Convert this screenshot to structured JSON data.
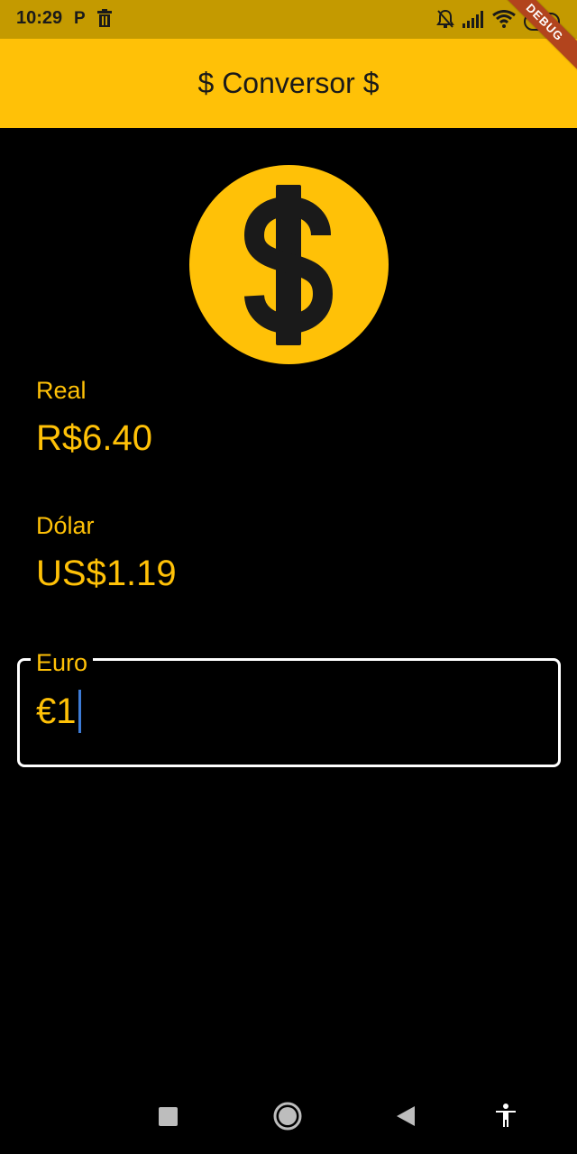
{
  "status_bar": {
    "time": "10:29",
    "battery": "71",
    "icons": [
      "parking-icon",
      "trash-icon",
      "bell-off-icon",
      "signal-icon",
      "wifi-icon",
      "battery-icon"
    ]
  },
  "debug_banner": "DEBUG",
  "app_bar": {
    "title": "$ Conversor $"
  },
  "coin": {
    "icon": "dollar-coin-icon",
    "color": "#ffc107"
  },
  "fields": {
    "real": {
      "label": "Real",
      "value": "R$6.40"
    },
    "dolar": {
      "label": "Dólar",
      "value": "US$1.19"
    },
    "euro": {
      "label": "Euro",
      "value": "€1"
    }
  },
  "nav_bar": {
    "buttons": [
      "recents-icon",
      "home-icon",
      "back-icon",
      "accessibility-icon"
    ]
  },
  "colors": {
    "accent": "#ffc107",
    "background": "#000000",
    "status_bar": "#c49a00",
    "caret": "#3d7bd6"
  }
}
